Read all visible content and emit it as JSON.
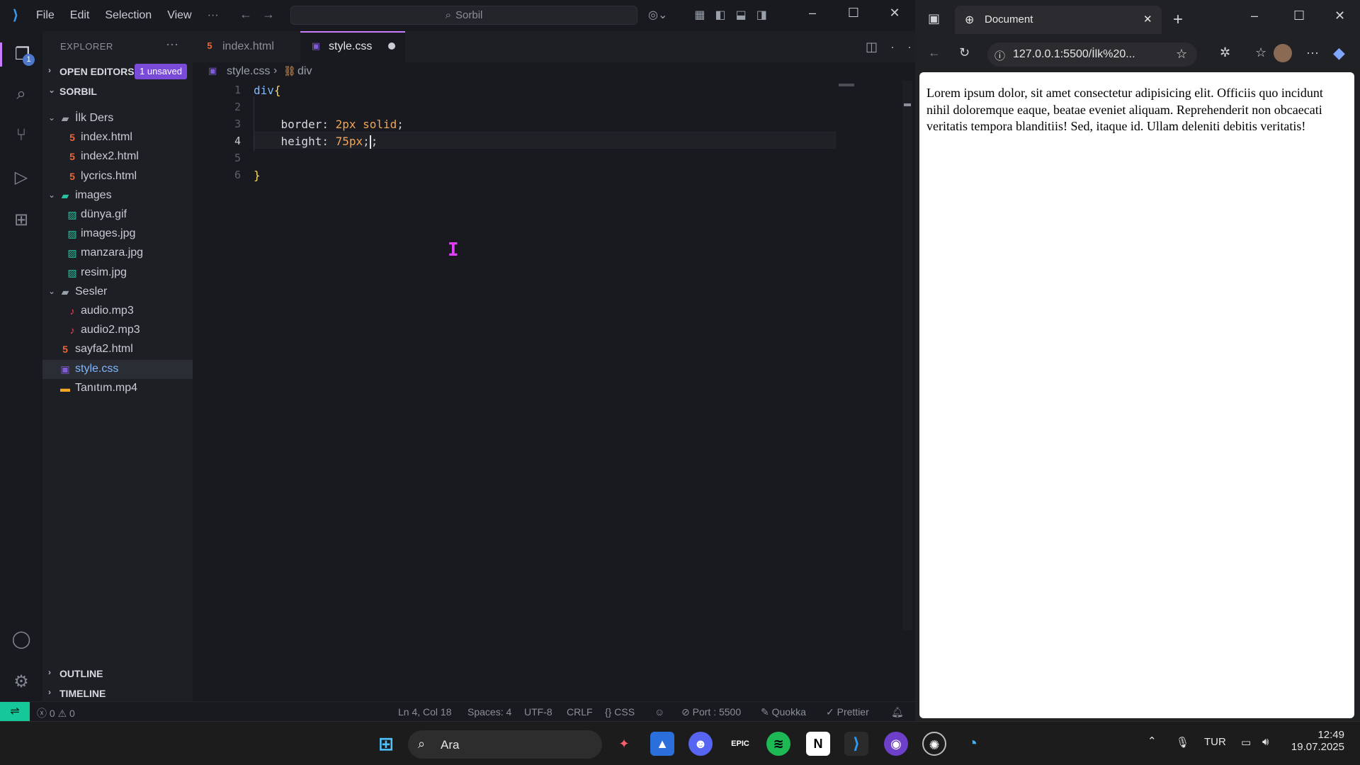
{
  "vscode": {
    "menu": [
      "File",
      "Edit",
      "Selection",
      "View"
    ],
    "command_center": "Sorbil",
    "explorer_title": "EXPLORER",
    "activity_badge": "1",
    "open_editors": {
      "label": "OPEN EDITORS",
      "badge": "1 unsaved"
    },
    "workspace": "SORBIL",
    "tree": [
      {
        "name": "İlk Ders",
        "type": "folder",
        "level": 1
      },
      {
        "name": "index.html",
        "type": "html",
        "level": 2
      },
      {
        "name": "index2.html",
        "type": "html",
        "level": 2
      },
      {
        "name": "lycrics.html",
        "type": "html",
        "level": 2
      },
      {
        "name": "images",
        "type": "folder-images",
        "level": 1
      },
      {
        "name": "dünya.gif",
        "type": "image",
        "level": 2
      },
      {
        "name": "images.jpg",
        "type": "image",
        "level": 2
      },
      {
        "name": "manzara.jpg",
        "type": "image",
        "level": 2
      },
      {
        "name": "resim.jpg",
        "type": "image",
        "level": 2
      },
      {
        "name": "Sesler",
        "type": "folder",
        "level": 1
      },
      {
        "name": "audio.mp3",
        "type": "audio",
        "level": 2
      },
      {
        "name": "audio2.mp3",
        "type": "audio",
        "level": 2
      },
      {
        "name": "sayfa2.html",
        "type": "html",
        "level": 1
      },
      {
        "name": "style.css",
        "type": "css",
        "level": 1,
        "selected": true
      },
      {
        "name": "Tanıtım.mp4",
        "type": "video",
        "level": 1
      }
    ],
    "outline": "OUTLINE",
    "timeline": "TIMELINE",
    "tabs": [
      {
        "name": "index.html",
        "type": "html",
        "active": false
      },
      {
        "name": "style.css",
        "type": "css",
        "active": true,
        "dirty": true
      }
    ],
    "breadcrumb": {
      "file": "style.css",
      "symbol": "div"
    },
    "code": {
      "line_numbers": [
        "1",
        "2",
        "3",
        "4",
        "5",
        "6"
      ],
      "selector": "div",
      "open_brace": "{",
      "prop1": "border",
      "val1": "2px solid",
      "prop2": "height",
      "val2": "75px",
      "close_brace": "}"
    },
    "status": {
      "errors": "0",
      "warnings": "0",
      "position": "Ln 4, Col 18",
      "spaces": "Spaces: 4",
      "encoding": "UTF-8",
      "eol": "CRLF",
      "language": "CSS",
      "port": "Port : 5500",
      "quokka": "Quokka",
      "prettier": "Prettier"
    }
  },
  "browser": {
    "tab_title": "Document",
    "address": "127.0.0.1:5500/İlk%20...",
    "content": "Lorem ipsum dolor, sit amet consectetur adipisicing elit. Officiis quo incidunt nihil doloremque eaque, beatae eveniet aliquam. Reprehenderit non obcaecati veritatis tempora blanditiis! Sed, itaque id. Ullam deleniti debitis veritatis!"
  },
  "taskbar": {
    "search_placeholder": "Ara",
    "language": "TUR",
    "time": "12:49",
    "date": "19.07.2025"
  },
  "colors": {
    "accent": "#c77dff",
    "remote": "#16c79a",
    "html_icon": "#e8663a",
    "css_icon": "#7f5bd6",
    "image_icon": "#27c2a0",
    "audio_icon": "#f0435a",
    "video_icon": "#f5a623"
  }
}
